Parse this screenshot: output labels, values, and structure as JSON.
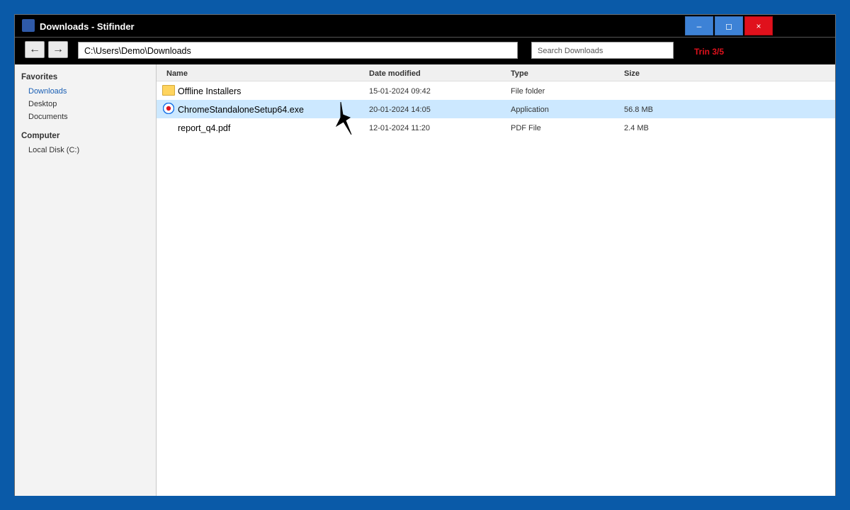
{
  "window": {
    "title": "Downloads - Stifinder",
    "controls": {
      "minimize": "–",
      "maximize": "◻",
      "close": "×"
    }
  },
  "toolbar": {
    "back": "←",
    "forward": "→",
    "address": "C:\\Users\\Demo\\Downloads",
    "search_placeholder": "Search Downloads",
    "step_label": "Trin 3/5"
  },
  "sidebar": {
    "favorites_heading": "Favorites",
    "favorites": [
      "Downloads",
      "Desktop",
      "Documents"
    ],
    "active_item": "Downloads",
    "computer_heading": "Computer",
    "computer_items": [
      "Local Disk (C:)"
    ]
  },
  "file_list": {
    "columns": [
      "Name",
      "Date modified",
      "Type",
      "Size"
    ],
    "rows": [
      {
        "icon": "folder-icon",
        "name": "Offline Installers",
        "date": "15-01-2024 09:42",
        "type": "File folder",
        "size": ""
      },
      {
        "icon": "chrome-icon",
        "name": "ChromeStandaloneSetup64.exe",
        "date": "20-01-2024 14:05",
        "type": "Application",
        "size": "56.8 MB",
        "selected": true
      },
      {
        "icon": "",
        "name": "report_q4.pdf",
        "date": "12-01-2024 11:20",
        "type": "PDF File",
        "size": "2.4 MB"
      }
    ]
  },
  "colors": {
    "desktop": "#0a5aa8",
    "titlebar": "#000000",
    "close_button": "#e0111c",
    "control_buttons": "#3d82d6",
    "selection": "#cce8ff",
    "step_label": "#e0111c",
    "sidebar_active": "#1a5fb4"
  }
}
